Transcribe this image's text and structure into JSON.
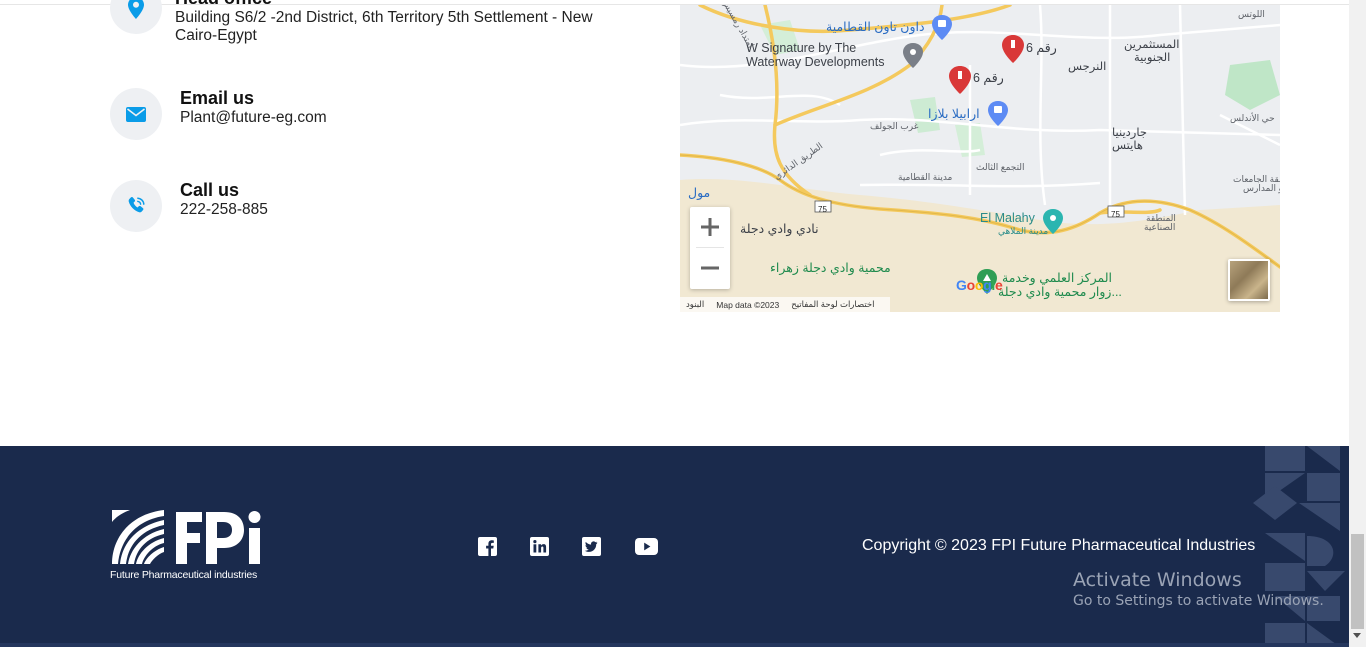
{
  "contact": {
    "head_office": {
      "title": "Head office",
      "value": "Building S6/2 -2nd District, 6th Territory 5th Settlement - New Cairo-Egypt"
    },
    "email": {
      "title": "Email us",
      "value": "Plant@future-eg.com"
    },
    "call": {
      "title": "Call us",
      "value": "222-258-885"
    }
  },
  "map": {
    "labels": {
      "downtown": "داون تاون القطامية",
      "w_signature_1": "W Signature by The",
      "w_signature_2": "Waterway Developments",
      "raqam6_top": "رقم 6",
      "raqam6_mid": "رقم 6",
      "arabella": "ارابيلا بلازا",
      "gharb_golf": "غرب الجولف",
      "tagamoa": "التجمع الثالث",
      "qattamia_city": "مدينة القطامية",
      "ring_road": "الطريق الدائري",
      "mostathmereen_1": "المستثمرين",
      "mostathmereen_2": "الجنوبية",
      "narges": "النرجس",
      "lotus": "اللوتس",
      "garden_1": "جاردينيا",
      "garden_2": "هايتس",
      "andalus": "حي الأندلس",
      "universities_1": "منطقة الجامعات",
      "universities_2": "و المدارس",
      "mall": "مول",
      "el_malahy": "El Malahy",
      "malahy_ar": "مدينة الملاهي",
      "industrial_1": "المنطقة",
      "industrial_2": "الصناعية",
      "wadi_degla_club": "نادي وادي دجلة",
      "wadi_degla_reserve": "محمية وادي دجلة زهراء",
      "science_center_1": "المركز العلمي وخدمة",
      "science_center_2": "زوار محمية وادي دجلة...",
      "road_75_a": "75",
      "road_75_b": "75",
      "amtidad": "امتداد رمسيس",
      "google": [
        "G",
        "o",
        "o",
        "g",
        "l",
        "e"
      ]
    },
    "footer": {
      "terms": "البنود",
      "map_data": "Map data ©2023",
      "shortcuts": "اختصارات لوحة المفاتيح"
    },
    "zoom_in": "+",
    "zoom_out": "−"
  },
  "footer": {
    "logo_text": "Future Pharmaceutical industries",
    "logo_brand": "FPi",
    "social": [
      "facebook-icon",
      "linkedin-icon",
      "twitter-icon",
      "youtube-icon"
    ],
    "copyright": "Copyright © 2023 FPI Future Pharmaceutical Industries",
    "background_color": "#1a2a4c"
  },
  "watermark": {
    "title": "Activate Windows",
    "subtitle": "Go to Settings to activate Windows."
  },
  "colors": {
    "icon_blue": "#0a9ce8",
    "map_pin_red": "#d93838",
    "road_yellow": "#f4c95d"
  }
}
